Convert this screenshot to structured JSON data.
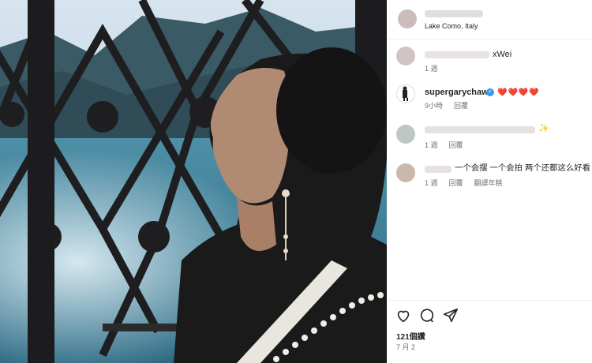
{
  "post": {
    "location": "Lake Como, Italy",
    "likes": "121個讚",
    "date": "7 月 2"
  },
  "comments": [
    {
      "username_suffix": "xWei",
      "text": "",
      "time": "1 週",
      "reply": ""
    },
    {
      "username": "supergarychaw",
      "verified": true,
      "text": "❤️❤️❤️❤️",
      "time": "9小時",
      "reply": "回覆"
    },
    {
      "text_suffix": "✨",
      "time": "1 週",
      "reply": "回覆"
    },
    {
      "text": "一个会摆 一个会拍 两个还都这么好看",
      "time": "1 週",
      "reply": "回覆",
      "translate": "翻譯年糕"
    }
  ],
  "icons": {
    "like": "heart-icon",
    "comment": "comment-icon",
    "share": "share-icon",
    "verified": "verified-badge-icon"
  },
  "colors": {
    "verified": "#3897f0",
    "heart": "#ed4956",
    "meta": "#737373"
  }
}
